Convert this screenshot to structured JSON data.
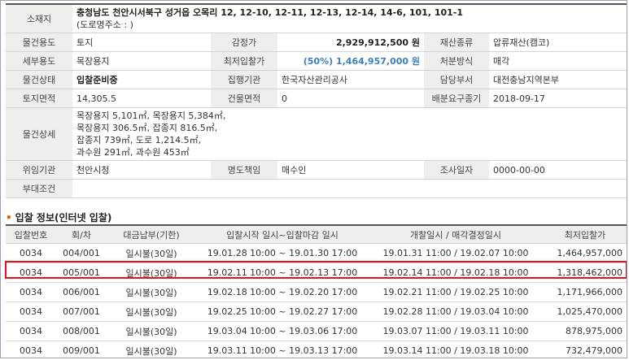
{
  "info": {
    "address_label": "소재지",
    "address": "충청남도 천안시서북구 성거읍 오목리 12, 12-10, 12-11, 12-13, 12-14, 14-6, 101, 101-1",
    "road_address": "(도로명주소 : )",
    "rows": [
      {
        "l1": "물건용도",
        "v1": "토지",
        "l2": "감정가",
        "v2": "2,929,912,500 원",
        "l3": "재산종류",
        "v3": "압류재산(캠코)"
      },
      {
        "l1": "세부용도",
        "v1": "목장용지",
        "l2": "최저입찰가",
        "v2": "(50%) 1,464,957,000 원",
        "l3": "처분방식",
        "v3": "매각"
      },
      {
        "l1": "물건상태",
        "v1": "입찰준비중",
        "l2": "집행기관",
        "v2": "한국자산관리공사",
        "l3": "담당부서",
        "v3": "대전충남지역본부"
      },
      {
        "l1": "토지면적",
        "v1": "14,305.5",
        "l2": "건물면적",
        "v2": "0",
        "l3": "배분요구종기",
        "v3": "2018-09-17"
      }
    ],
    "detail_label": "물건상세",
    "detail_lines": [
      "목장용지 5,101㎡, 목장용지 5,384㎡,",
      "목장용지 306.5㎡, 잡종지 816.5㎡,",
      "잡종지 739㎡, 도로 1,214.5㎡,",
      "과수원 291㎡, 과수원 453㎡"
    ],
    "delegate": {
      "l1": "위임기관",
      "v1": "천안시청",
      "l2": "명도책임",
      "v2": "매수인",
      "l3": "조사일자",
      "v3": "0000-00-00"
    },
    "condition_label": "부대조건",
    "condition_value": ""
  },
  "bid_section_title": "입찰 정보(인터넷 입찰)",
  "bid_table": {
    "headers": [
      "입찰번호",
      "회/차",
      "대금납부(기한)",
      "입찰시작 일시~입찰마감 일시",
      "개찰일시 / 매각결정일시",
      "최저입찰가"
    ],
    "rows": [
      [
        "0034",
        "004/001",
        "일시불(30일)",
        "19.01.28 10:00 ~ 19.01.30 17:00",
        "19.01.31 11:00 / 19.02.07 10:00",
        "1,464,957,000"
      ],
      [
        "0034",
        "005/001",
        "일시불(30일)",
        "19.02.11 10:00 ~ 19.02.13 17:00",
        "19.02.14 11:00 / 19.02.18 10:00",
        "1,318,462,000"
      ],
      [
        "0034",
        "006/001",
        "일시불(30일)",
        "19.02.18 10:00 ~ 19.02.20 17:00",
        "19.02.21 11:00 / 19.02.25 10:00",
        "1,171,966,000"
      ],
      [
        "0034",
        "007/001",
        "일시불(30일)",
        "19.02.25 10:00 ~ 19.02.27 17:00",
        "19.02.28 11:00 / 19.03.04 10:00",
        "1,025,470,000"
      ],
      [
        "0034",
        "008/001",
        "일시불(30일)",
        "19.03.04 10:00 ~ 19.03.06 17:00",
        "19.03.07 11:00 / 19.03.11 10:00",
        "878,975,000"
      ],
      [
        "0034",
        "009/001",
        "일시불(30일)",
        "19.03.11 10:00 ~ 19.03.13 17:00",
        "19.03.14 11:00 / 19.03.18 10:00",
        "732,479,000"
      ]
    ],
    "highlighted_row": 1
  },
  "colors": {
    "highlight": "#e8101a",
    "blue_value": "#3a7fbf",
    "bullet": "#e05a00"
  }
}
